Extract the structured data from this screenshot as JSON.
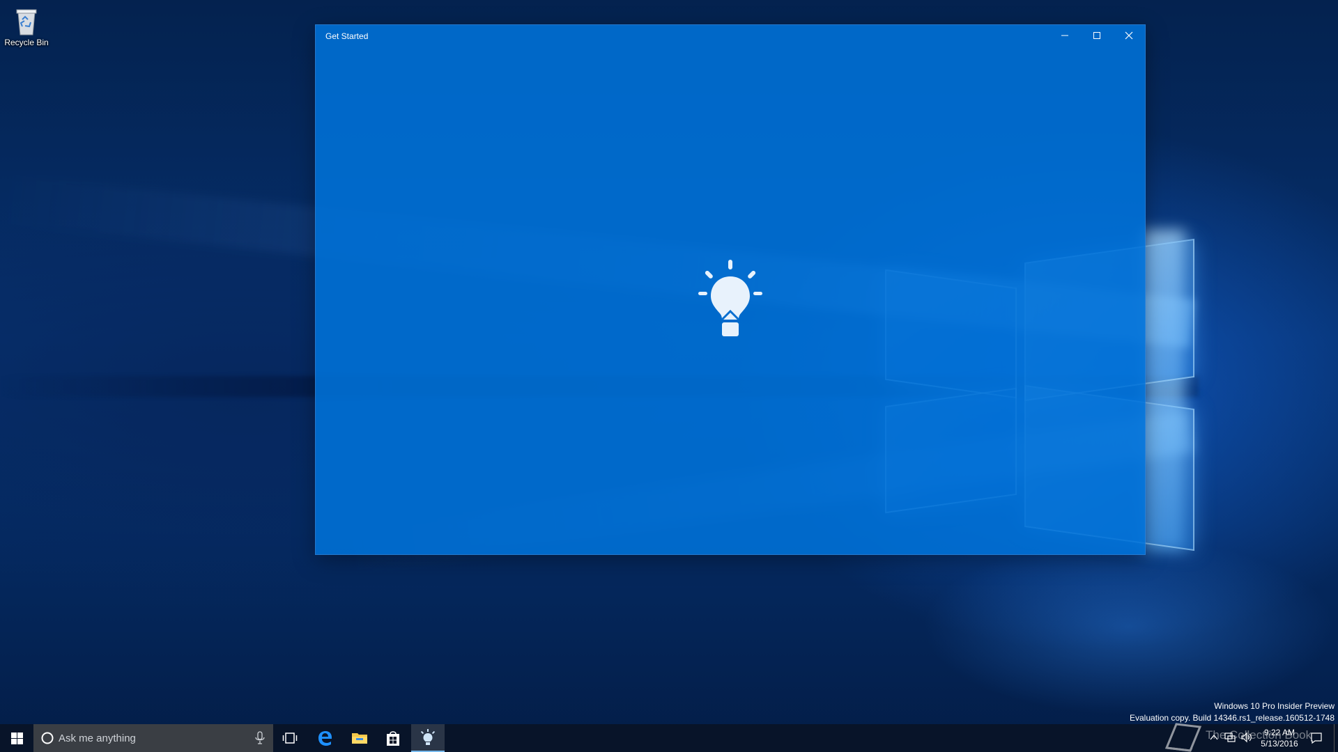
{
  "desktop": {
    "icons": [
      {
        "label": "Recycle Bin",
        "icon": "recycle-bin-icon"
      }
    ],
    "build_info": {
      "edition": "Windows 10 Pro Insider Preview",
      "build": "Evaluation copy. Build 14346.rs1_release.160512-1748"
    }
  },
  "window": {
    "title": "Get Started",
    "splash_icon": "lightbulb-icon",
    "accent_color": "#0078d7",
    "controls": {
      "minimize": "minimize-icon",
      "maximize": "maximize-icon",
      "close": "close-icon"
    }
  },
  "taskbar": {
    "search_placeholder": "Ask me anything",
    "apps": [
      "task-view-icon",
      "edge-icon",
      "file-explorer-icon",
      "store-icon",
      "get-started-icon"
    ],
    "active_app": "Get Started",
    "tray": {
      "time": "9:22 AM",
      "date": "5/13/2016"
    },
    "watermark": "The Collection Book"
  }
}
